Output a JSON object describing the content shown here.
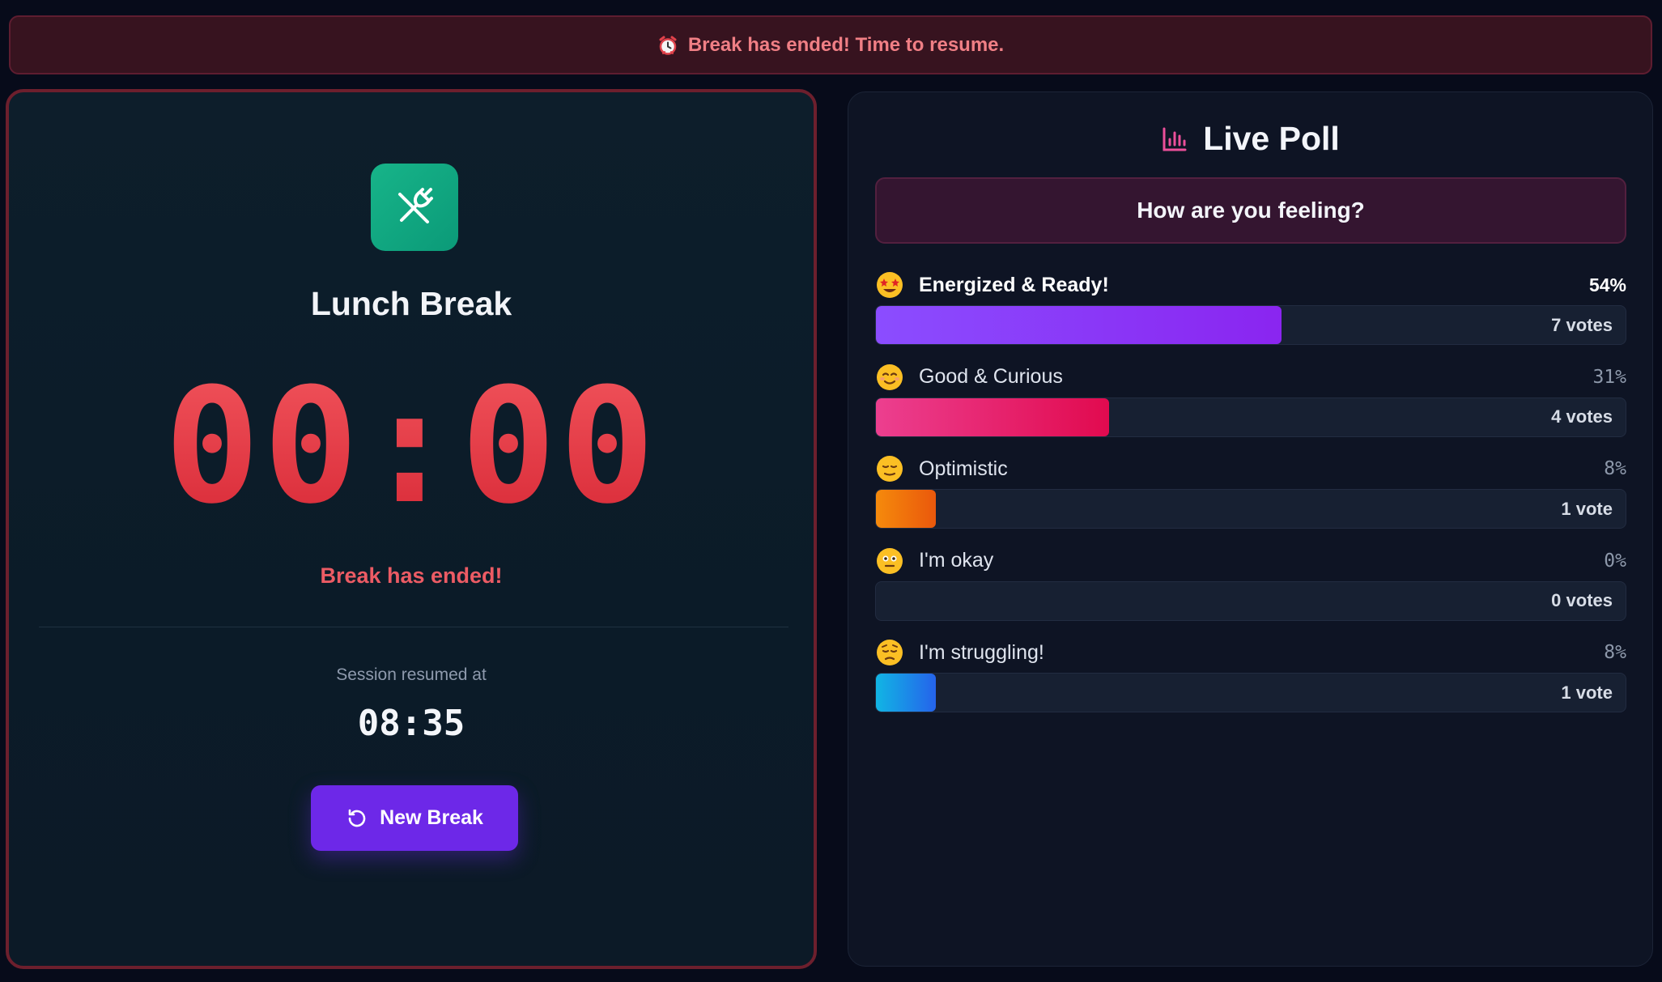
{
  "banner": {
    "icon": "alarm-clock-icon",
    "text": "Break has ended! Time to resume."
  },
  "timer": {
    "icon": "utensils-icon",
    "title": "Lunch Break",
    "clock": "00:00",
    "status": "Break has ended!",
    "resumed_label": "Session resumed at",
    "resumed_time": "08:35",
    "button_label": "New Break",
    "button_icon": "restart-icon"
  },
  "poll": {
    "icon": "bar-chart-icon",
    "title": "Live Poll",
    "question": "How are you feeling?",
    "options": [
      {
        "emoji": "star-struck-emoji",
        "label": "Energized & Ready!",
        "pct": "54%",
        "votes": "7 votes",
        "fraction": 0.54,
        "colors": [
          "#8b4dff",
          "#8a25f0"
        ]
      },
      {
        "emoji": "smiling-emoji",
        "label": "Good & Curious",
        "pct": "31%",
        "votes": "4 votes",
        "fraction": 0.31,
        "colors": [
          "#ec3f8f",
          "#e10a4f"
        ]
      },
      {
        "emoji": "relieved-emoji",
        "label": "Optimistic",
        "pct": "8%",
        "votes": "1 vote",
        "fraction": 0.08,
        "colors": [
          "#f58a0c",
          "#ea580c"
        ]
      },
      {
        "emoji": "neutral-emoji",
        "label": "I'm okay",
        "pct": "0%",
        "votes": "0 votes",
        "fraction": 0.0,
        "colors": [
          "#3b4660",
          "#3b4660"
        ]
      },
      {
        "emoji": "pensive-emoji",
        "label": "I'm struggling!",
        "pct": "8%",
        "votes": "1 vote",
        "fraction": 0.08,
        "colors": [
          "#11b5e4",
          "#2563eb"
        ]
      }
    ]
  }
}
